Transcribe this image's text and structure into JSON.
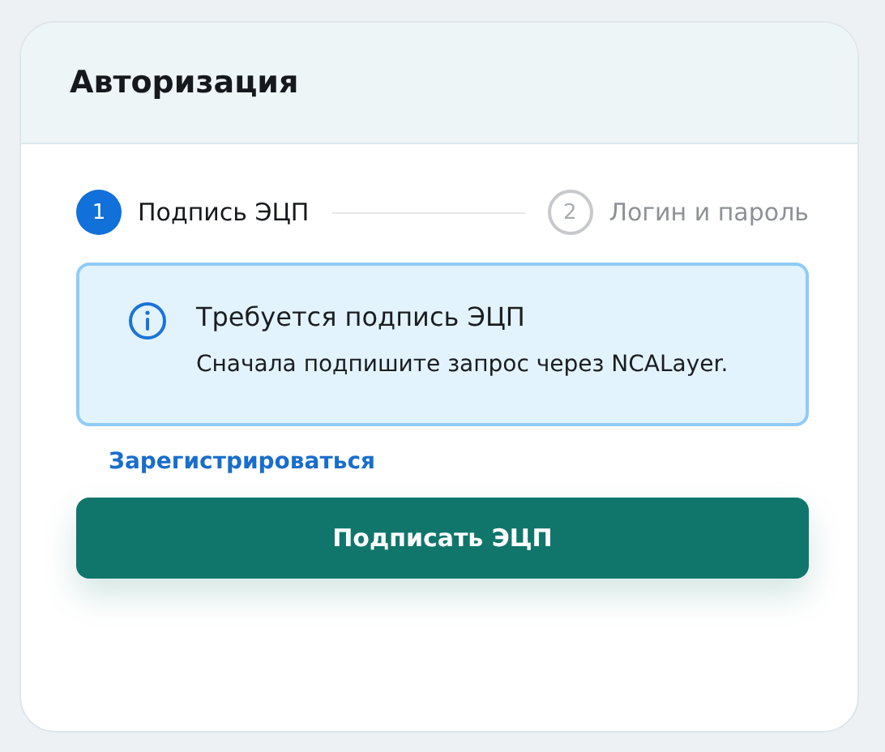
{
  "card": {
    "title": "Авторизация"
  },
  "steps": [
    {
      "number": "1",
      "label": "Подпись ЭЦП",
      "active": true
    },
    {
      "number": "2",
      "label": "Логин и пароль",
      "active": false
    }
  ],
  "alert": {
    "title": "Требуется подпись ЭЦП",
    "message": "Сначала подпишите запрос через NCALayer."
  },
  "register_link": "Зарегистрироваться",
  "sign_button": "Подписать ЭЦП"
}
